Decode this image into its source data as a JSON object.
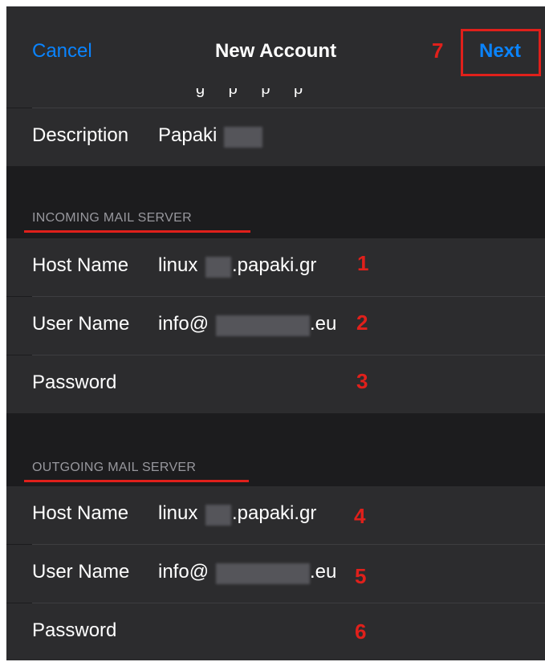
{
  "nav": {
    "cancel": "Cancel",
    "title": "New Account",
    "next": "Next",
    "next_marker": "7"
  },
  "account": {
    "partial_row_text": "g p p p",
    "description_label": "Description",
    "description_value": "Papaki"
  },
  "incoming": {
    "header": "INCOMING MAIL SERVER",
    "host_label": "Host Name",
    "host_prefix": "linux",
    "host_suffix": ".papaki.gr",
    "host_marker": "1",
    "user_label": "User Name",
    "user_prefix": "info@",
    "user_suffix": ".eu",
    "user_marker": "2",
    "password_label": "Password",
    "password_marker": "3"
  },
  "outgoing": {
    "header": "OUTGOING MAIL SERVER",
    "host_label": "Host Name",
    "host_prefix": "linux",
    "host_suffix": ".papaki.gr",
    "host_marker": "4",
    "user_label": "User Name",
    "user_prefix": "info@",
    "user_suffix": ".eu",
    "user_marker": "5",
    "password_label": "Password",
    "password_marker": "6"
  },
  "colors": {
    "accent": "#0a84ff",
    "annotation": "#e0201b",
    "background": "#1c1c1e",
    "cell": "#2c2c2e"
  }
}
